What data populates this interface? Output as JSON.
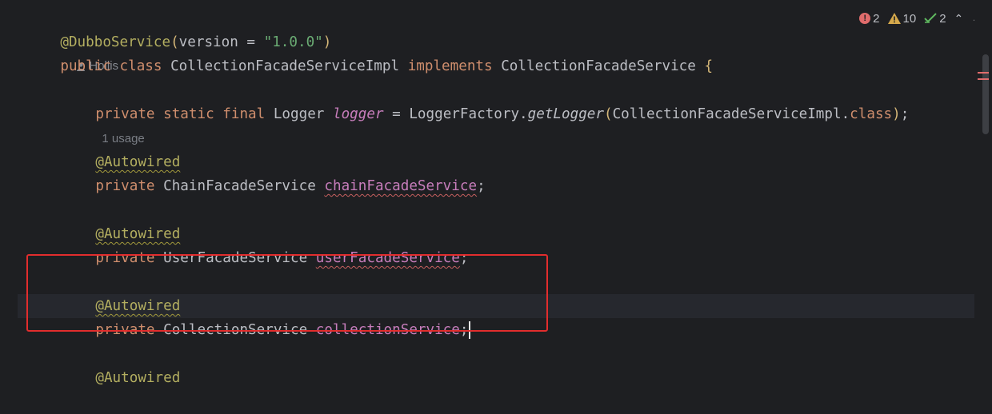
{
  "author": "Hollis",
  "inspections": {
    "errors": "2",
    "warnings": "10",
    "ok": "2"
  },
  "code": {
    "line1": {
      "annotation": "@DubboService",
      "open": "(",
      "param": "version = ",
      "value": "\"1.0.0\"",
      "close": ")"
    },
    "line2": {
      "kw1": "public",
      "kw2": "class",
      "class_name": "CollectionFacadeServiceImpl",
      "kw3": "implements",
      "iface": "CollectionFacadeService",
      "brace": "{"
    },
    "line4": {
      "kw1": "private",
      "kw2": "static",
      "kw3": "final",
      "type": "Logger",
      "name": "logger",
      "eq": " = ",
      "factory": "LoggerFactory.",
      "method": "getLogger",
      "open": "(",
      "arg": "CollectionFacadeServiceImpl.",
      "arg_kw": "class",
      "close": ")",
      "semi": ";",
      "usage_hint": "1 usage"
    },
    "field1": {
      "annotation": "@Autowired",
      "kw": "private",
      "type": "ChainFacadeService",
      "name": "chainFacadeService",
      "semi": ";"
    },
    "field2": {
      "annotation": "@Autowired",
      "kw": "private",
      "type": "UserFacadeService",
      "name": "userFacadeService",
      "semi": ";"
    },
    "field3": {
      "annotation": "@Autowired",
      "kw": "private",
      "type": "CollectionService",
      "name": "collectionService",
      "semi": ";"
    },
    "field4": {
      "annotation": "@Autowired"
    }
  },
  "colors": {
    "keyword": "#cf8e6d",
    "annotation": "#b3ae60",
    "string": "#6aab73",
    "field": "#c77dbb",
    "highlight_box": "#e22d2d"
  },
  "icons": {
    "author": "user-icon",
    "errors": "error-icon",
    "warnings": "warning-icon",
    "ok": "check-icon",
    "collapse": "chevron-up-icon",
    "expand": "chevron-down-icon"
  }
}
